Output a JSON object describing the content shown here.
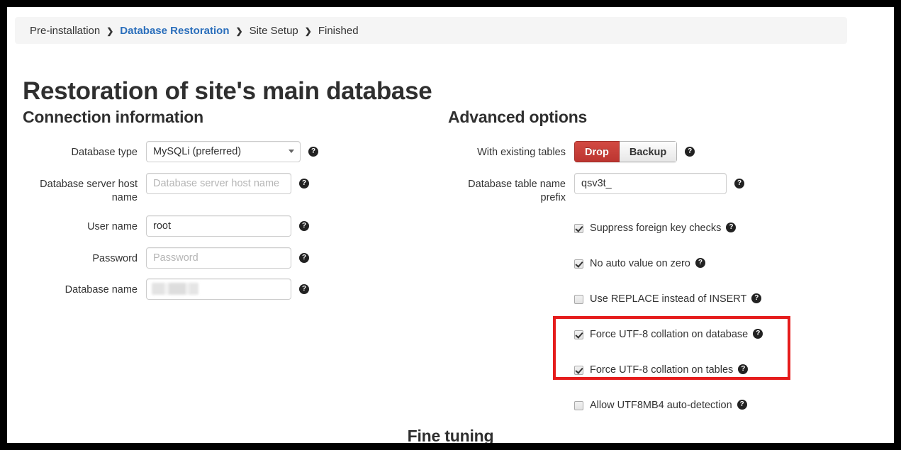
{
  "breadcrumb": {
    "separator": "❯",
    "items": [
      {
        "label": "Pre-installation",
        "active": false
      },
      {
        "label": "Database Restoration",
        "active": true
      },
      {
        "label": "Site Setup",
        "active": false
      },
      {
        "label": "Finished",
        "active": false
      }
    ]
  },
  "page_title": "Restoration of site's main database",
  "help_glyph": "?",
  "connection": {
    "section_title": "Connection information",
    "fields": {
      "database_type": {
        "label": "Database type",
        "value": "MySQLi (preferred)",
        "options": [
          "MySQLi (preferred)"
        ]
      },
      "host_name": {
        "label": "Database server host name",
        "value": "",
        "placeholder": "Database server host name"
      },
      "user_name": {
        "label": "User name",
        "value": "root",
        "placeholder": ""
      },
      "password": {
        "label": "Password",
        "value": "",
        "placeholder": "Password"
      },
      "database_name": {
        "label": "Database name",
        "value": "",
        "placeholder": "",
        "redacted": true
      }
    }
  },
  "advanced": {
    "section_title": "Advanced options",
    "existing_tables": {
      "label": "With existing tables",
      "selected": "Drop",
      "options": [
        "Drop",
        "Backup"
      ],
      "active_color": "#bc3530"
    },
    "table_prefix": {
      "label": "Database table name prefix",
      "value": "qsv3t_",
      "placeholder": ""
    },
    "checkboxes": [
      {
        "label": "Suppress foreign key checks",
        "checked": true,
        "highlighted": false
      },
      {
        "label": "No auto value on zero",
        "checked": true,
        "highlighted": false
      },
      {
        "label": "Use REPLACE instead of INSERT",
        "checked": false,
        "highlighted": false
      },
      {
        "label": "Force UTF-8 collation on database",
        "checked": true,
        "highlighted": true
      },
      {
        "label": "Force UTF-8 collation on tables",
        "checked": true,
        "highlighted": true
      },
      {
        "label": "Allow UTF8MB4 auto-detection",
        "checked": false,
        "highlighted": false
      }
    ]
  },
  "fine_tuning_title": "Fine tuning",
  "highlight": {
    "color": "#e51c1c"
  }
}
